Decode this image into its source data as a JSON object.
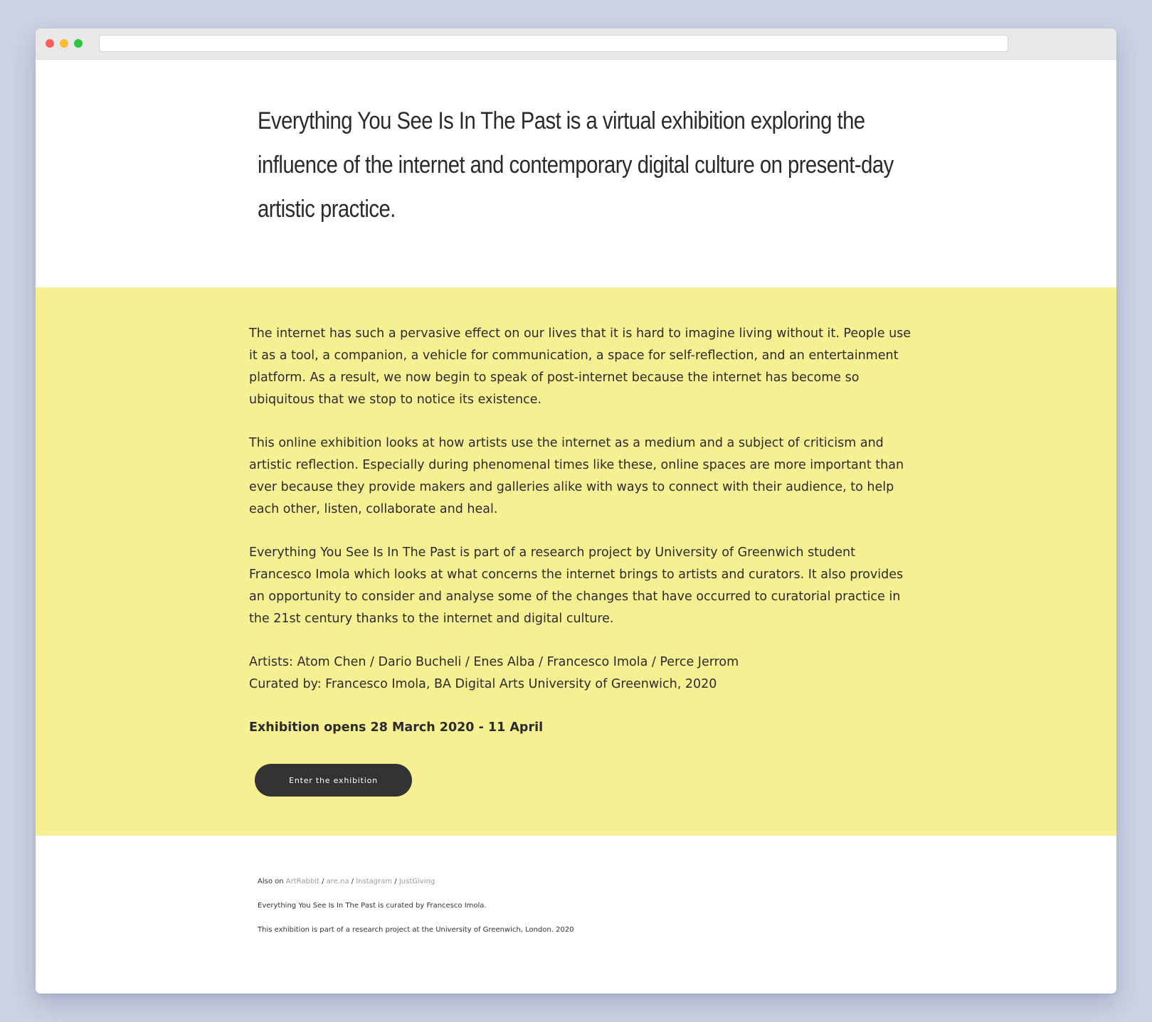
{
  "hero": {
    "text": "Everything You See Is In The Past is a virtual exhibition exploring the influence of the internet and contemporary digital culture on present-day artistic practice."
  },
  "body": {
    "paragraph1": "The internet has such a pervasive effect on our lives that it is hard to imagine living without it. People use it as a tool, a companion, a vehicle for communication, a space for self-reflection, and an entertainment platform. As a result, we now begin to speak of post-internet because the internet has become so ubiquitous that we stop to notice its existence.",
    "paragraph2": "This online exhibition looks at how artists use the internet as a medium and a subject of criticism and artistic reflection. Especially during phenomenal times like these, online spaces are more important than ever because they provide makers and galleries alike with ways to connect with their audience, to help each other, listen, collaborate and heal.",
    "paragraph3": "Everything You See Is In The Past is part of a research project by University of Greenwich student Francesco Imola which looks at what concerns the internet brings to artists and curators. It also provides an opportunity to consider and analyse some of the changes that have occurred to curatorial practice in the 21st century thanks to the internet and digital culture.",
    "artists": "Artists: Atom Chen / Dario Bucheli / Enes Alba / Francesco Imola / Perce Jerrom",
    "curated": "Curated by: Francesco Imola, BA Digital Arts University of Greenwich, 2020",
    "opens": "Exhibition opens 28 March 2020 - 11 April",
    "button_label": "Enter the exhibition"
  },
  "footer": {
    "also_on_label": "Also on",
    "separator": "/",
    "links": [
      "ArtRabbit",
      "are.na",
      "Instagram",
      "JustGiving"
    ],
    "curated_line": "Everything You See Is In The Past is curated by Francesco Imola.",
    "research_line": "This exhibition is part of a research project at the University of Greenwich, London. 2020"
  }
}
